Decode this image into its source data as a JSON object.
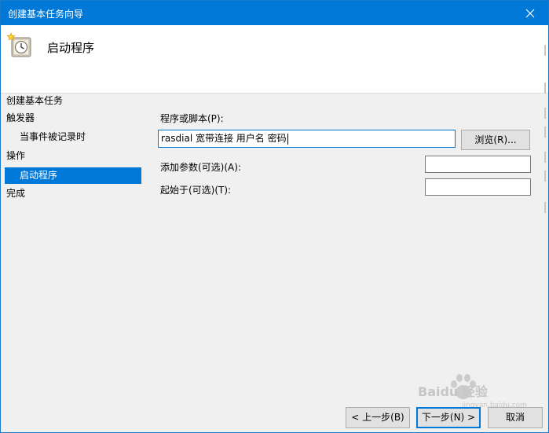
{
  "window": {
    "title": "创建基本任务向导",
    "close_icon": "close-icon"
  },
  "header": {
    "icon": "clock-task-icon",
    "title": "启动程序"
  },
  "nav": {
    "section_title": "创建基本任务",
    "items": [
      {
        "label": "触发器",
        "selected": false
      },
      {
        "label": "当事件被记录时",
        "selected": false
      },
      {
        "label": "操作",
        "selected": false
      },
      {
        "label": "启动程序",
        "selected": true
      },
      {
        "label": "完成",
        "selected": false
      }
    ]
  },
  "form": {
    "program_label": "程序或脚本(P):",
    "program_value": "rasdial 宽带连接 用户名 密码",
    "browse_label": "浏览(R)...",
    "args_label": "添加参数(可选)(A):",
    "args_value": "",
    "startin_label": "起始于(可选)(T):",
    "startin_value": ""
  },
  "footer": {
    "back_label": "< 上一步(B)",
    "next_label": "下一步(N) >",
    "cancel_label": "取消"
  },
  "watermark": {
    "text": "Baidu 经验",
    "subtext": "jingyan.baidu.com"
  },
  "colors": {
    "titlebar": "#0078d7",
    "selection": "#0078d7",
    "background": "#f0f0f0"
  }
}
